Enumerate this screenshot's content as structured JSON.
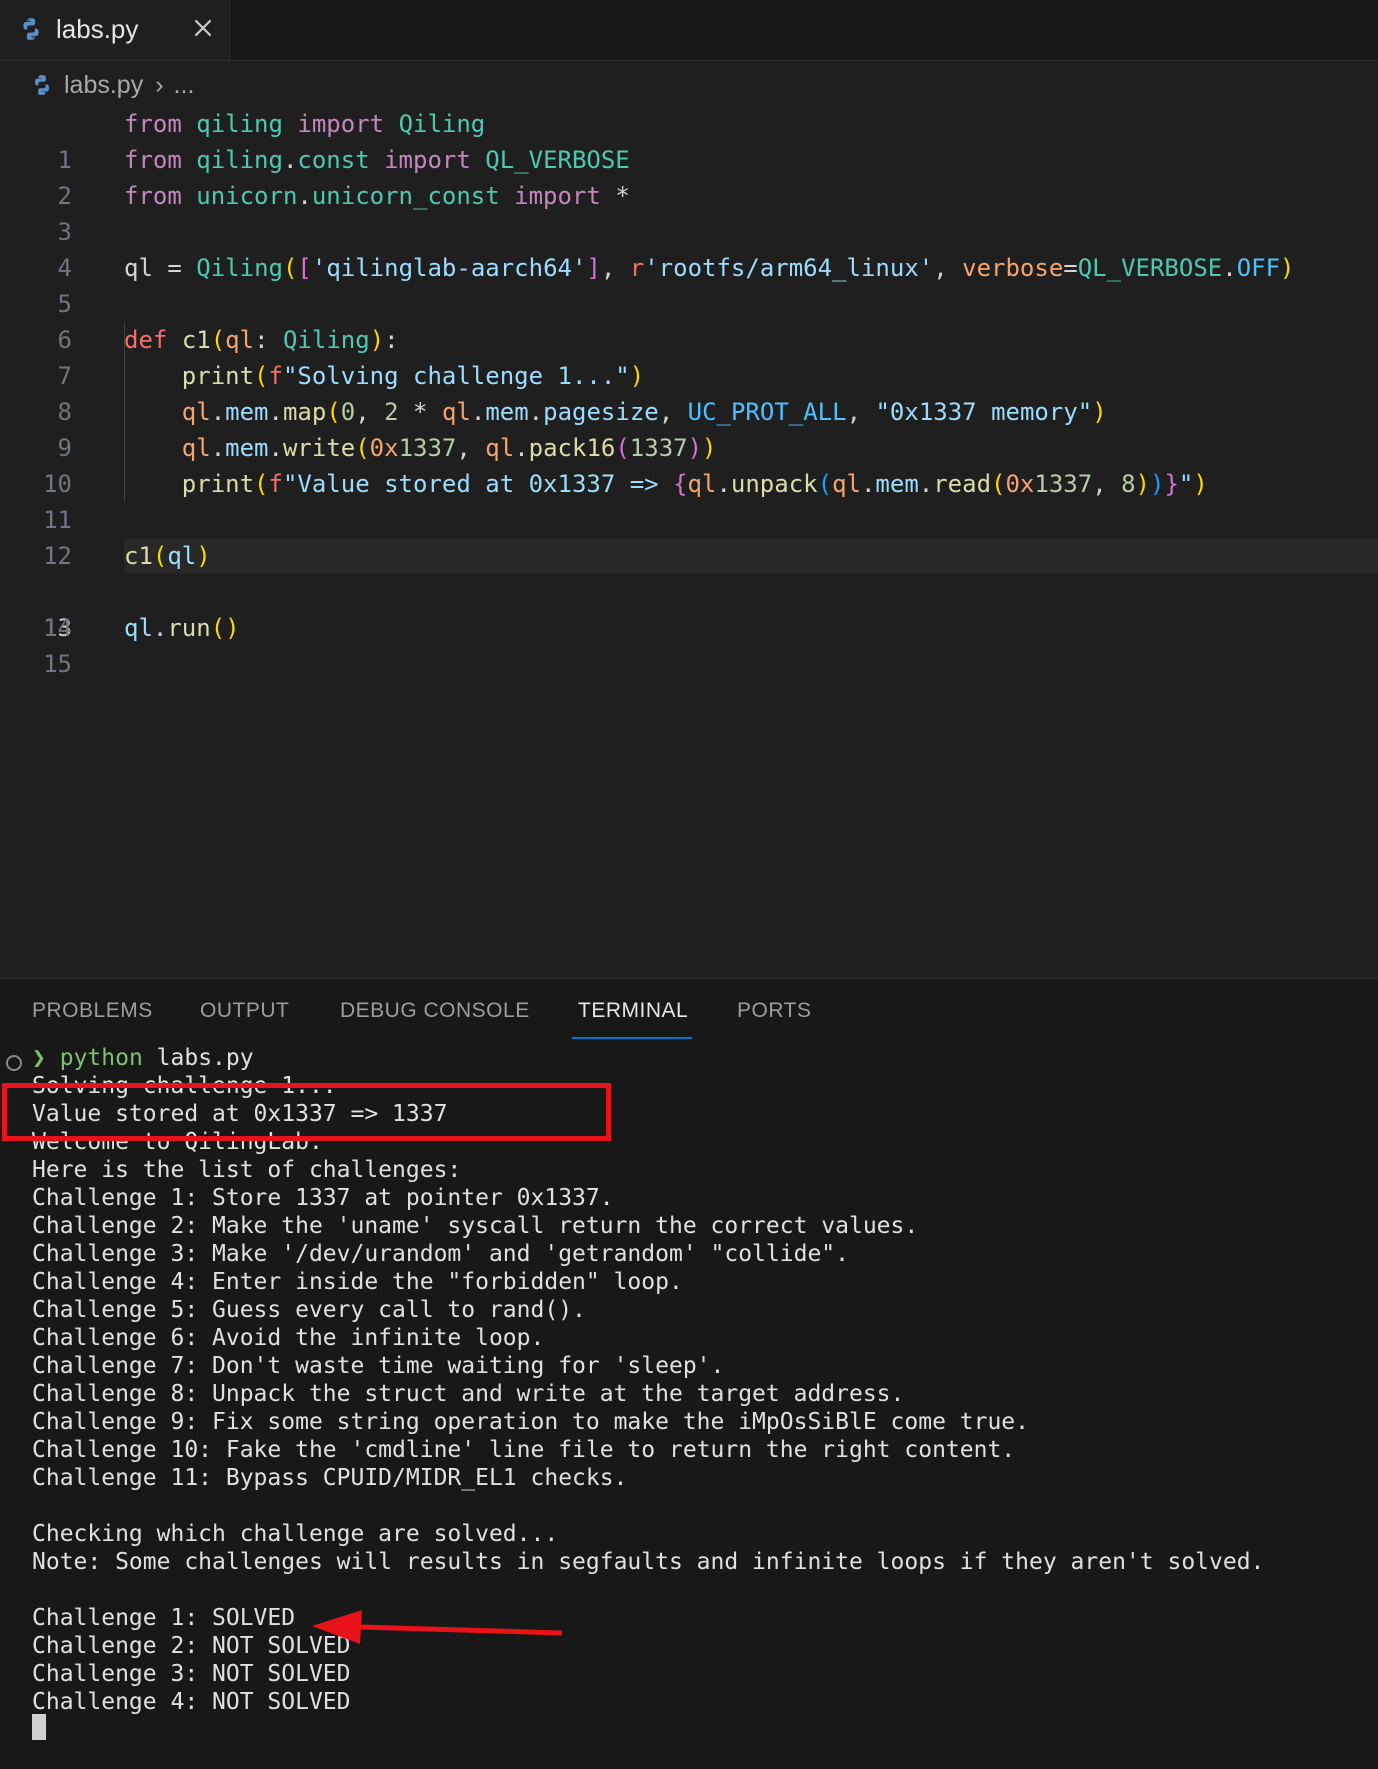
{
  "tab": {
    "label": "labs.py"
  },
  "breadcrumb": {
    "file": "labs.py",
    "rest": "..."
  },
  "editor": {
    "line_numbers": [
      "1",
      "2",
      "3",
      "4",
      "5",
      "6",
      "7",
      "8",
      "9",
      "10",
      "11",
      "12",
      "13",
      "14",
      "15"
    ],
    "current_line": 13
  },
  "panel": {
    "tabs": [
      "PROBLEMS",
      "OUTPUT",
      "DEBUG CONSOLE",
      "TERMINAL",
      "PORTS"
    ],
    "active_tab": "TERMINAL"
  },
  "terminal": {
    "prompt_symbol": "❯",
    "command": "python",
    "command_arg": "labs.py",
    "lines": [
      "Solving challenge 1...",
      "Value stored at 0x1337 => 1337",
      "Welcome to QilingLab.",
      "Here is the list of challenges:",
      "Challenge 1: Store 1337 at pointer 0x1337.",
      "Challenge 2: Make the 'uname' syscall return the correct values.",
      "Challenge 3: Make '/dev/urandom' and 'getrandom' \"collide\".",
      "Challenge 4: Enter inside the \"forbidden\" loop.",
      "Challenge 5: Guess every call to rand().",
      "Challenge 6: Avoid the infinite loop.",
      "Challenge 7: Don't waste time waiting for 'sleep'.",
      "Challenge 8: Unpack the struct and write at the target address.",
      "Challenge 9: Fix some string operation to make the iMpOsSiBlE come true.",
      "Challenge 10: Fake the 'cmdline' line file to return the right content.",
      "Challenge 11: Bypass CPUID/MIDR_EL1 checks.",
      "",
      "Checking which challenge are solved...",
      "Note: Some challenges will results in segfaults and infinite loops if they aren't solved.",
      "",
      "Challenge 1: SOLVED",
      "Challenge 2: NOT SOLVED",
      "Challenge 3: NOT SOLVED",
      "Challenge 4: NOT SOLVED"
    ]
  },
  "code": {
    "l1": [
      "from",
      "qiling",
      "import",
      "Qiling"
    ],
    "l2": [
      "from",
      "qiling",
      ".",
      "const",
      "import",
      "QL_VERBOSE"
    ],
    "l3": [
      "from",
      "unicorn",
      ".",
      "unicorn_const",
      "import",
      "*"
    ],
    "l5": [
      "ql",
      " = ",
      "Qiling",
      "(",
      "[",
      "'qilinglab-aarch64'",
      "]",
      ", ",
      "r",
      "'rootfs/arm64_linux'",
      ", ",
      "verbose",
      "=",
      "QL_VERBOSE",
      ".",
      "OFF",
      ")"
    ],
    "l7": [
      "def",
      "c1",
      "(",
      "ql",
      ": ",
      "Qiling",
      ")",
      ":"
    ],
    "l8": [
      "print",
      "(",
      "f",
      "\"Solving challenge 1...\"",
      ")"
    ],
    "l9": [
      "ql",
      ".",
      "mem",
      ".",
      "map",
      "(",
      "0",
      ", ",
      "2",
      " * ",
      "ql",
      ".",
      "mem",
      ".",
      "pagesize",
      ", ",
      "UC_PROT_ALL",
      ", ",
      "\"0x1337 memory\"",
      ")"
    ],
    "l10": [
      "ql",
      ".",
      "mem",
      ".",
      "write",
      "(",
      "0x",
      "1337",
      ", ",
      "ql",
      ".",
      "pack16",
      "(",
      "1337",
      ")",
      ")"
    ],
    "l11": [
      "print",
      "(",
      "f",
      "\"Value stored at 0x1337 => ",
      "{",
      "ql",
      ".",
      "unpack",
      "(",
      "ql",
      ".",
      "mem",
      ".",
      "read",
      "(",
      "0x",
      "1337",
      ", ",
      "8",
      ")",
      ")",
      "}",
      "\"",
      ")"
    ],
    "l13": [
      "c1",
      "(",
      "ql",
      ")"
    ],
    "l15": [
      "ql",
      ".",
      "run",
      "(",
      ")"
    ]
  },
  "colors": {
    "accent": "#0078d4",
    "annotation_red": "#e8121a",
    "prompt_green": "#7ec16e"
  }
}
